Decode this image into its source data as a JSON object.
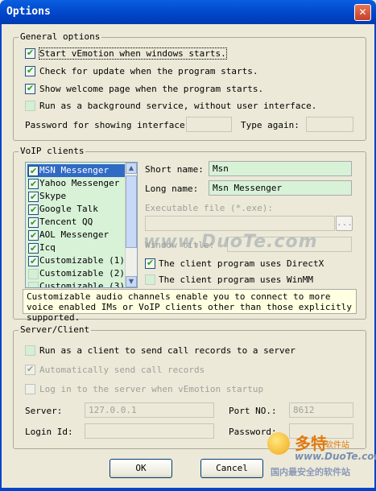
{
  "window": {
    "title": "Options",
    "close_glyph": "✕"
  },
  "general": {
    "group_title": "General options",
    "start_with_windows": {
      "label": "Start vEmotion when windows starts.",
      "checked": true
    },
    "check_update": {
      "label": "Check for update when the program starts.",
      "checked": true
    },
    "show_welcome": {
      "label": "Show welcome page when the program starts.",
      "checked": true
    },
    "background_service": {
      "label": "Run as a background service, without user interface.",
      "checked": false
    },
    "password_label": "Password for showing interface:",
    "password_value": "",
    "type_again_label": "Type again:",
    "type_again_value": ""
  },
  "voip": {
    "group_title": "VoIP clients",
    "clients": [
      {
        "label": "MSN Messenger",
        "checked": true,
        "selected": true
      },
      {
        "label": "Yahoo Messenger",
        "checked": true
      },
      {
        "label": "Skype",
        "checked": true
      },
      {
        "label": "Google Talk",
        "checked": true
      },
      {
        "label": "Tencent QQ",
        "checked": true
      },
      {
        "label": "AOL Messenger",
        "checked": true
      },
      {
        "label": "Icq",
        "checked": true
      },
      {
        "label": "Customizable (1)",
        "checked": true
      },
      {
        "label": "Customizable (2)",
        "checked": false
      },
      {
        "label": "Customizable (3)",
        "checked": false
      }
    ],
    "short_name_label": "Short name:",
    "short_name_value": "Msn",
    "long_name_label": "Long name:",
    "long_name_value": "Msn Messenger",
    "exe_label": "Executable file (*.exe):",
    "exe_value": "",
    "browse_label": "...",
    "window_title_label": "Window title:",
    "window_title_value": "",
    "uses_directx": {
      "label": "The client program uses DirectX",
      "checked": true
    },
    "uses_winmm": {
      "label": "The client program uses WinMM",
      "checked": false
    },
    "info_text": "Customizable audio channels enable you to connect to more voice enabled IMs or VoIP clients other than those explicitly supported."
  },
  "server": {
    "group_title": "Server/Client",
    "run_as_client": {
      "label": "Run as a client to send call records to a server",
      "checked": false
    },
    "auto_send": {
      "label": "Automatically send call records",
      "checked": true
    },
    "log_in": {
      "label": "Log in to the server when vEmotion startup",
      "checked": false
    },
    "server_label": "Server:",
    "server_value": "127.0.0.1",
    "port_label": "Port NO.:",
    "port_value": "8612",
    "login_label": "Login Id:",
    "login_value": "",
    "password_label": "Password:",
    "password_value": ""
  },
  "buttons": {
    "ok": "OK",
    "cancel": "Cancel"
  },
  "watermark": {
    "text": "www.DuoTe.com"
  },
  "logo": {
    "big": "多特",
    "small": "软件站",
    "url": "www.DuoTe.com",
    "cn": "国内最安全的软件站"
  }
}
